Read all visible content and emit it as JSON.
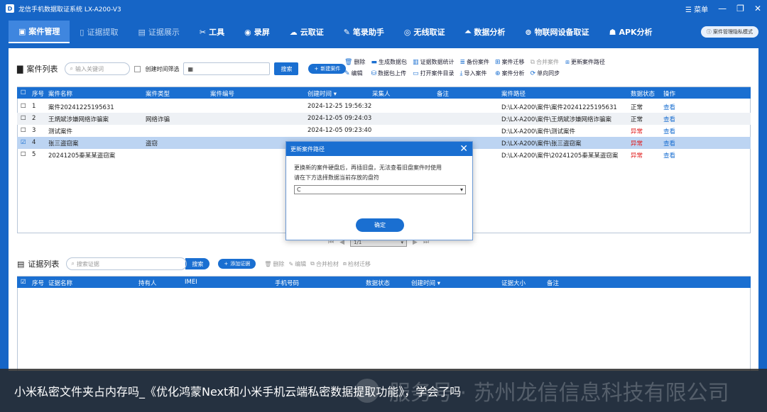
{
  "app": {
    "title": "龙信手机数据取证系统 LX-A200-V3",
    "menu_label": "菜单"
  },
  "menubar": {
    "items": [
      {
        "label": "案件管理",
        "icon": "folder-icon"
      },
      {
        "label": "证据提取",
        "icon": "phone-icon"
      },
      {
        "label": "证据展示",
        "icon": "display-icon"
      },
      {
        "label": "工具",
        "icon": "tools-icon"
      },
      {
        "label": "录屏",
        "icon": "record-icon"
      },
      {
        "label": "云取证",
        "icon": "cloud-icon"
      },
      {
        "label": "笔录助手",
        "icon": "notes-icon"
      },
      {
        "label": "无线取证",
        "icon": "wireless-icon"
      },
      {
        "label": "数据分析",
        "icon": "analysis-icon"
      },
      {
        "label": "物联网设备取证",
        "icon": "iot-icon"
      },
      {
        "label": "APK分析",
        "icon": "android-icon"
      }
    ],
    "mode_button": "案件管理隐私模式"
  },
  "case_section": {
    "title": "案件列表",
    "search_placeholder": "输入关键词",
    "date_filter_label": "创建时间筛选",
    "search_button": "搜索",
    "new_button": "新建案件",
    "tools_row1": [
      "删除",
      "生成数据包",
      "证据数据统计",
      "备份案件",
      "案件迁移",
      "合并案件",
      "更新案件路径"
    ],
    "tools_row2": [
      "编辑",
      "数据包上传",
      "打开案件目录",
      "导入案件",
      "案件分析",
      "单向同步"
    ],
    "columns": [
      "序号",
      "案件名称",
      "案件类型",
      "案件编号",
      "创建时间",
      "采集人",
      "备注",
      "案件路径",
      "数据状态",
      "操作"
    ],
    "rows": [
      {
        "no": "1",
        "name": "案件20241225195631",
        "type": "",
        "number": "",
        "created": "2024-12-25 19:56:32",
        "collector": "",
        "remark": "",
        "path": "D:\\LX-A200\\案件\\案件20241225195631",
        "status": "正常",
        "action": "查看"
      },
      {
        "no": "2",
        "name": "王炳斌涉嫌网络诈骗案",
        "type": "网络诈骗",
        "number": "",
        "created": "2024-12-05 09:24:03",
        "collector": "",
        "remark": "",
        "path": "D:\\LX-A200\\案件\\王炳斌涉嫌网络诈骗案",
        "status": "正常",
        "action": "查看"
      },
      {
        "no": "3",
        "name": "测试案件",
        "type": "",
        "number": "",
        "created": "2024-12-05 09:23:40",
        "collector": "",
        "remark": "",
        "path": "D:\\LX-A200\\案件\\测试案件",
        "status": "异常",
        "action": "查看"
      },
      {
        "no": "4",
        "name": "张三盗窃案",
        "type": "盗窃",
        "number": "",
        "created": "",
        "collector": "",
        "remark": "",
        "path": "D:\\LX-A200\\案件\\张三盗窃案",
        "status": "异常",
        "action": "查看"
      },
      {
        "no": "5",
        "name": "20241205秦某某盗窃案",
        "type": "",
        "number": "",
        "created": "",
        "collector": "",
        "remark": "",
        "path": "D:\\LX-A200\\案件\\20241205秦某某盗窃案",
        "status": "异常",
        "action": "查看"
      }
    ],
    "pager": "1/1"
  },
  "evidence_section": {
    "title": "证据列表",
    "search_placeholder": "搜索证据",
    "search_button": "搜索",
    "add_button": "添加证据",
    "tools": [
      "删除",
      "编辑",
      "合并检材",
      "检材迁移"
    ],
    "columns": [
      "序号",
      "证据名称",
      "持有人",
      "IMEI",
      "手机号码",
      "数据状态",
      "创建时间",
      "证据大小",
      "备注"
    ]
  },
  "dialog": {
    "title": "更新案件路径",
    "line1": "更换新的案件硬盘后，再插旧盘，无法查看旧盘案件时使用",
    "line2": "请在下方选择数据当前存放的盘符",
    "select_value": "C",
    "ok_button": "确定"
  },
  "banner": {
    "text": "小米私密文件夹占内存吗_《优化鸿蒙Next和小米手机云端私密数据提取功能》，学会了吗",
    "watermark": "服务号 · 苏州龙信信息科技有限公司"
  },
  "colors": {
    "primary": "#1a6fd1",
    "frame": "#1665c6",
    "abnormal": "#e01c1c"
  }
}
